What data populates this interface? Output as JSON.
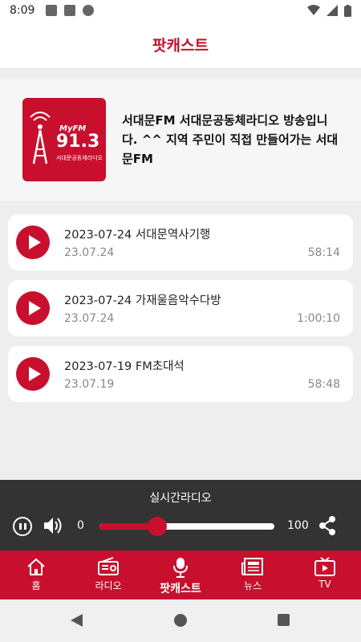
{
  "status_bar": {
    "time": "8:09"
  },
  "header": {
    "title": "팟캐스트"
  },
  "channel": {
    "logo_brand": "MyFM",
    "logo_freq": "91.3",
    "logo_sub": "서대문공동체라디오",
    "description": "서대문FM 서대문공동체라디오 방송입니다. ^^ 지역 주민이 직접 만들어가는 서대문FM"
  },
  "episodes": [
    {
      "title": "2023-07-24 서대문역사기행",
      "date": "23.07.24",
      "duration": "58:14"
    },
    {
      "title": "2023-07-24 가재울음악수다방",
      "date": "23.07.24",
      "duration": "1:00:10"
    },
    {
      "title": "2023-07-19 FM초대석",
      "date": "23.07.19",
      "duration": "58:48"
    }
  ],
  "player": {
    "title": "실시간라디오",
    "volume_min": "0",
    "volume_max": "100",
    "volume_level_percent": 33
  },
  "nav": {
    "items": [
      {
        "label": "홈",
        "icon": "home-icon"
      },
      {
        "label": "라디오",
        "icon": "radio-icon"
      },
      {
        "label": "팟캐스트",
        "icon": "microphone-icon",
        "active": true
      },
      {
        "label": "뉴스",
        "icon": "newspaper-icon"
      },
      {
        "label": "TV",
        "icon": "tv-icon"
      }
    ]
  },
  "colors": {
    "accent": "#c8102e",
    "player_bg": "#333333",
    "header_title": "#c0122c"
  }
}
